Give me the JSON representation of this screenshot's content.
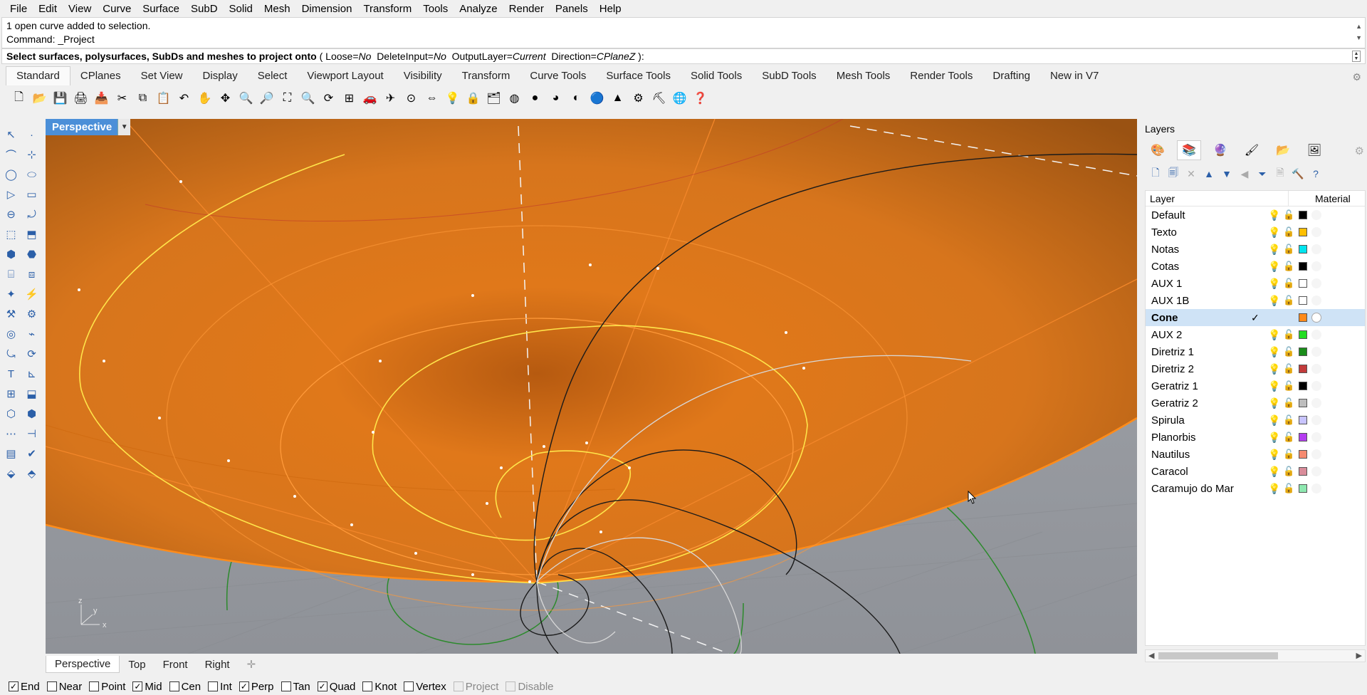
{
  "menu": [
    "File",
    "Edit",
    "View",
    "Curve",
    "Surface",
    "SubD",
    "Solid",
    "Mesh",
    "Dimension",
    "Transform",
    "Tools",
    "Analyze",
    "Render",
    "Panels",
    "Help"
  ],
  "command": {
    "history": [
      "1 open curve added to selection.",
      "Command: _Project"
    ],
    "prompt_bold": "Select surfaces, polysurfaces, SubDs and meshes to project onto",
    "options": [
      {
        "name": "Loose",
        "value": "No"
      },
      {
        "name": "DeleteInput",
        "value": "No"
      },
      {
        "name": "OutputLayer",
        "value": "Current"
      },
      {
        "name": "Direction",
        "value": "CPlaneZ"
      }
    ],
    "prompt_open": " ( ",
    "prompt_close": " ):"
  },
  "tabs": [
    "Standard",
    "CPlanes",
    "Set View",
    "Display",
    "Select",
    "Viewport Layout",
    "Visibility",
    "Transform",
    "Curve Tools",
    "Surface Tools",
    "Solid Tools",
    "SubD Tools",
    "Mesh Tools",
    "Render Tools",
    "Drafting",
    "New in V7"
  ],
  "active_tab": "Standard",
  "toolbar_icons": [
    "new-icon",
    "open-icon",
    "save-icon",
    "print-icon",
    "import-icon",
    "cut-icon",
    "copy-icon",
    "paste-icon",
    "undo-icon",
    "pan-icon",
    "move-view-icon",
    "zoom-icon",
    "zoom-window-icon",
    "zoom-extents-icon",
    "zoom-selected-icon",
    "rotate-view-icon",
    "four-views-icon",
    "car-icon",
    "plane-icon",
    "point-icon",
    "move-icon",
    "bulb-icon",
    "lock-icon",
    "layer-icon",
    "color-wheel-icon",
    "sphere-shaded-icon",
    "sphere-rendered-icon",
    "sphere-ghost-icon",
    "sphere-blue-icon",
    "cone-icon",
    "gear-settings-icon",
    "tool-icon",
    "globe-icon",
    "help-icon"
  ],
  "viewport": {
    "name": "Perspective",
    "axes": {
      "z": "z",
      "y": "y",
      "x": "x"
    }
  },
  "viewport_tabs": [
    "Perspective",
    "Top",
    "Front",
    "Right"
  ],
  "osnaps": [
    {
      "label": "End",
      "checked": true
    },
    {
      "label": "Near",
      "checked": false
    },
    {
      "label": "Point",
      "checked": false
    },
    {
      "label": "Mid",
      "checked": true
    },
    {
      "label": "Cen",
      "checked": false
    },
    {
      "label": "Int",
      "checked": false
    },
    {
      "label": "Perp",
      "checked": true
    },
    {
      "label": "Tan",
      "checked": false
    },
    {
      "label": "Quad",
      "checked": true
    },
    {
      "label": "Knot",
      "checked": false
    },
    {
      "label": "Vertex",
      "checked": false
    },
    {
      "label": "Project",
      "checked": false,
      "disabled": true
    },
    {
      "label": "Disable",
      "checked": false,
      "disabled": true
    }
  ],
  "panel": {
    "title": "Layers",
    "col_layer": "Layer",
    "col_material": "Material",
    "layers": [
      {
        "name": "Default",
        "color": "#000000"
      },
      {
        "name": "Texto",
        "color": "#ffbf00"
      },
      {
        "name": "Notas",
        "color": "#00e5ef"
      },
      {
        "name": "Cotas",
        "color": "#000000"
      },
      {
        "name": "AUX 1",
        "color": "#ffffff"
      },
      {
        "name": "AUX 1B",
        "color": "#ffffff"
      },
      {
        "name": "Cone",
        "color": "#ff8a1a",
        "current": true
      },
      {
        "name": "AUX 2",
        "color": "#22dd22"
      },
      {
        "name": "Diretriz 1",
        "color": "#1a8c1a"
      },
      {
        "name": "Diretriz 2",
        "color": "#c23b3b"
      },
      {
        "name": "Geratriz 1",
        "color": "#000000"
      },
      {
        "name": "Geratriz 2",
        "color": "#bdbdbd"
      },
      {
        "name": "Spirula",
        "color": "#c8c4ff"
      },
      {
        "name": "Planorbis",
        "color": "#b43cf0"
      },
      {
        "name": "Nautilus",
        "color": "#f58a70"
      },
      {
        "name": "Caracol",
        "color": "#d98c9a"
      },
      {
        "name": "Caramujo do Mar",
        "color": "#8ee8b0"
      }
    ]
  }
}
